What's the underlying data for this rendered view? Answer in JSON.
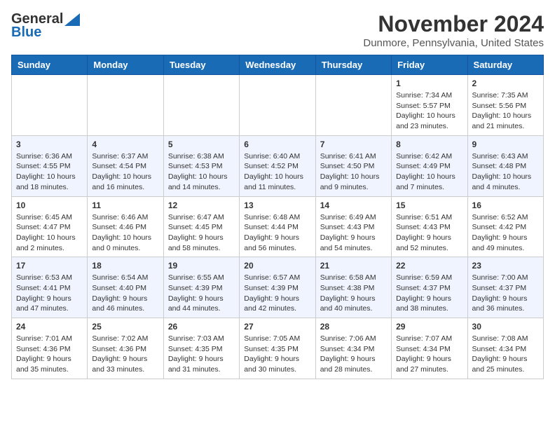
{
  "logo": {
    "line1": "General",
    "line2": "Blue"
  },
  "title": "November 2024",
  "location": "Dunmore, Pennsylvania, United States",
  "days_of_week": [
    "Sunday",
    "Monday",
    "Tuesday",
    "Wednesday",
    "Thursday",
    "Friday",
    "Saturday"
  ],
  "weeks": [
    [
      {
        "day": "",
        "text": ""
      },
      {
        "day": "",
        "text": ""
      },
      {
        "day": "",
        "text": ""
      },
      {
        "day": "",
        "text": ""
      },
      {
        "day": "",
        "text": ""
      },
      {
        "day": "1",
        "text": "Sunrise: 7:34 AM\nSunset: 5:57 PM\nDaylight: 10 hours and 23 minutes."
      },
      {
        "day": "2",
        "text": "Sunrise: 7:35 AM\nSunset: 5:56 PM\nDaylight: 10 hours and 21 minutes."
      }
    ],
    [
      {
        "day": "3",
        "text": "Sunrise: 6:36 AM\nSunset: 4:55 PM\nDaylight: 10 hours and 18 minutes."
      },
      {
        "day": "4",
        "text": "Sunrise: 6:37 AM\nSunset: 4:54 PM\nDaylight: 10 hours and 16 minutes."
      },
      {
        "day": "5",
        "text": "Sunrise: 6:38 AM\nSunset: 4:53 PM\nDaylight: 10 hours and 14 minutes."
      },
      {
        "day": "6",
        "text": "Sunrise: 6:40 AM\nSunset: 4:52 PM\nDaylight: 10 hours and 11 minutes."
      },
      {
        "day": "7",
        "text": "Sunrise: 6:41 AM\nSunset: 4:50 PM\nDaylight: 10 hours and 9 minutes."
      },
      {
        "day": "8",
        "text": "Sunrise: 6:42 AM\nSunset: 4:49 PM\nDaylight: 10 hours and 7 minutes."
      },
      {
        "day": "9",
        "text": "Sunrise: 6:43 AM\nSunset: 4:48 PM\nDaylight: 10 hours and 4 minutes."
      }
    ],
    [
      {
        "day": "10",
        "text": "Sunrise: 6:45 AM\nSunset: 4:47 PM\nDaylight: 10 hours and 2 minutes."
      },
      {
        "day": "11",
        "text": "Sunrise: 6:46 AM\nSunset: 4:46 PM\nDaylight: 10 hours and 0 minutes."
      },
      {
        "day": "12",
        "text": "Sunrise: 6:47 AM\nSunset: 4:45 PM\nDaylight: 9 hours and 58 minutes."
      },
      {
        "day": "13",
        "text": "Sunrise: 6:48 AM\nSunset: 4:44 PM\nDaylight: 9 hours and 56 minutes."
      },
      {
        "day": "14",
        "text": "Sunrise: 6:49 AM\nSunset: 4:43 PM\nDaylight: 9 hours and 54 minutes."
      },
      {
        "day": "15",
        "text": "Sunrise: 6:51 AM\nSunset: 4:43 PM\nDaylight: 9 hours and 52 minutes."
      },
      {
        "day": "16",
        "text": "Sunrise: 6:52 AM\nSunset: 4:42 PM\nDaylight: 9 hours and 49 minutes."
      }
    ],
    [
      {
        "day": "17",
        "text": "Sunrise: 6:53 AM\nSunset: 4:41 PM\nDaylight: 9 hours and 47 minutes."
      },
      {
        "day": "18",
        "text": "Sunrise: 6:54 AM\nSunset: 4:40 PM\nDaylight: 9 hours and 46 minutes."
      },
      {
        "day": "19",
        "text": "Sunrise: 6:55 AM\nSunset: 4:39 PM\nDaylight: 9 hours and 44 minutes."
      },
      {
        "day": "20",
        "text": "Sunrise: 6:57 AM\nSunset: 4:39 PM\nDaylight: 9 hours and 42 minutes."
      },
      {
        "day": "21",
        "text": "Sunrise: 6:58 AM\nSunset: 4:38 PM\nDaylight: 9 hours and 40 minutes."
      },
      {
        "day": "22",
        "text": "Sunrise: 6:59 AM\nSunset: 4:37 PM\nDaylight: 9 hours and 38 minutes."
      },
      {
        "day": "23",
        "text": "Sunrise: 7:00 AM\nSunset: 4:37 PM\nDaylight: 9 hours and 36 minutes."
      }
    ],
    [
      {
        "day": "24",
        "text": "Sunrise: 7:01 AM\nSunset: 4:36 PM\nDaylight: 9 hours and 35 minutes."
      },
      {
        "day": "25",
        "text": "Sunrise: 7:02 AM\nSunset: 4:36 PM\nDaylight: 9 hours and 33 minutes."
      },
      {
        "day": "26",
        "text": "Sunrise: 7:03 AM\nSunset: 4:35 PM\nDaylight: 9 hours and 31 minutes."
      },
      {
        "day": "27",
        "text": "Sunrise: 7:05 AM\nSunset: 4:35 PM\nDaylight: 9 hours and 30 minutes."
      },
      {
        "day": "28",
        "text": "Sunrise: 7:06 AM\nSunset: 4:34 PM\nDaylight: 9 hours and 28 minutes."
      },
      {
        "day": "29",
        "text": "Sunrise: 7:07 AM\nSunset: 4:34 PM\nDaylight: 9 hours and 27 minutes."
      },
      {
        "day": "30",
        "text": "Sunrise: 7:08 AM\nSunset: 4:34 PM\nDaylight: 9 hours and 25 minutes."
      }
    ]
  ]
}
